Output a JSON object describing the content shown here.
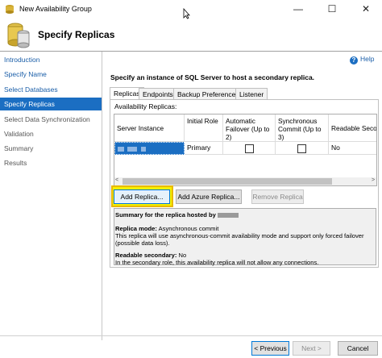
{
  "window": {
    "title": "New Availability Group",
    "minimize_glyph": "—",
    "maximize_glyph": "☐",
    "close_glyph": "✕"
  },
  "header": {
    "title": "Specify Replicas"
  },
  "sidebar": {
    "items": [
      {
        "label": "Introduction",
        "state": "link"
      },
      {
        "label": "Specify Name",
        "state": "link"
      },
      {
        "label": "Select Databases",
        "state": "link"
      },
      {
        "label": "Specify Replicas",
        "state": "active"
      },
      {
        "label": "Select Data Synchronization",
        "state": "disabled"
      },
      {
        "label": "Validation",
        "state": "disabled"
      },
      {
        "label": "Summary",
        "state": "disabled"
      },
      {
        "label": "Results",
        "state": "disabled"
      }
    ]
  },
  "help": {
    "icon": "help-icon",
    "label": "Help"
  },
  "main": {
    "instruction": "Specify an instance of SQL Server to host a secondary replica.",
    "tabs": [
      {
        "label": "Replicas",
        "selected": true
      },
      {
        "label": "Endpoints",
        "selected": false
      },
      {
        "label": "Backup Preferences",
        "selected": false
      },
      {
        "label": "Listener",
        "selected": false
      }
    ],
    "grid_label": "Availability Replicas:",
    "columns": [
      "Server Instance",
      "Initial Role",
      "Automatic Failover (Up to 2)",
      "Synchronous Commit (Up to 3)",
      "Readable Seco"
    ],
    "rows": [
      {
        "server_instance": "",
        "initial_role": "Primary",
        "automatic_failover": false,
        "synchronous_commit": false,
        "readable_secondary": "No"
      }
    ],
    "buttons": {
      "add_replica": "Add Replica...",
      "add_azure_replica": "Add Azure Replica...",
      "remove_replica": "Remove Replica"
    },
    "summary": {
      "title": "Summary for the replica hosted by",
      "replica_mode_label": "Replica mode:",
      "replica_mode_value": "Asynchronous commit",
      "replica_mode_desc": "This replica will use asynchronous-commit availability mode and support only forced failover (possible data loss).",
      "readable_label": "Readable secondary:",
      "readable_value": "No",
      "readable_desc": "In the secondary role, this availability replica will not allow any connections."
    }
  },
  "footer": {
    "previous": "< Previous",
    "next": "Next >",
    "cancel": "Cancel"
  },
  "colors": {
    "accent": "#1b6ec2",
    "link": "#1a5ea8",
    "highlight": "#f6f000"
  }
}
